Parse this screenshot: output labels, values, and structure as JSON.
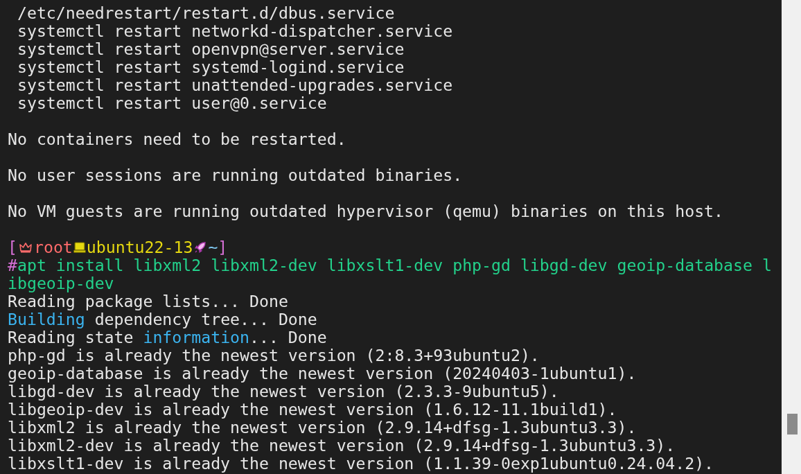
{
  "lines": [
    {
      "kind": "text",
      "segments": [
        {
          "text": " /etc/needrestart/restart.d/dbus.service",
          "color": "#e6e6e6"
        }
      ]
    },
    {
      "kind": "text",
      "segments": [
        {
          "text": " systemctl restart networkd-dispatcher.service",
          "color": "#e6e6e6"
        }
      ]
    },
    {
      "kind": "text",
      "segments": [
        {
          "text": " systemctl restart openvpn@server.service",
          "color": "#e6e6e6"
        }
      ]
    },
    {
      "kind": "text",
      "segments": [
        {
          "text": " systemctl restart systemd-logind.service",
          "color": "#e6e6e6"
        }
      ]
    },
    {
      "kind": "text",
      "segments": [
        {
          "text": " systemctl restart unattended-upgrades.service",
          "color": "#e6e6e6"
        }
      ]
    },
    {
      "kind": "text",
      "segments": [
        {
          "text": " systemctl restart user@0.service",
          "color": "#e6e6e6"
        }
      ]
    },
    {
      "kind": "blank"
    },
    {
      "kind": "text",
      "segments": [
        {
          "text": "No containers need to be restarted.",
          "color": "#e6e6e6"
        }
      ]
    },
    {
      "kind": "blank"
    },
    {
      "kind": "text",
      "segments": [
        {
          "text": "No user sessions are running outdated binaries.",
          "color": "#e6e6e6"
        }
      ]
    },
    {
      "kind": "blank"
    },
    {
      "kind": "text",
      "segments": [
        {
          "text": "No VM guests are running outdated hypervisor (qemu) binaries on this host.",
          "color": "#e6e6e6"
        }
      ]
    },
    {
      "kind": "blank"
    },
    {
      "kind": "prompt",
      "open": "[",
      "user": "root",
      "host": "ubuntu22-13",
      "cwd": "~",
      "close": "]"
    },
    {
      "kind": "text",
      "segments": [
        {
          "text": "#",
          "color": "#d670d6"
        },
        {
          "text": "apt install libxml2 libxml2-dev libxslt1-dev php-gd libgd-dev geoip-database l",
          "color": "#23d18b"
        }
      ]
    },
    {
      "kind": "text",
      "segments": [
        {
          "text": "ibgeoip-dev",
          "color": "#23d18b"
        }
      ]
    },
    {
      "kind": "text",
      "segments": [
        {
          "text": "Reading package lists... Done",
          "color": "#e6e6e6"
        }
      ]
    },
    {
      "kind": "text",
      "segments": [
        {
          "text": "Building",
          "color": "#3bb4f0"
        },
        {
          "text": " dependency tree... Done",
          "color": "#e6e6e6"
        }
      ]
    },
    {
      "kind": "text",
      "segments": [
        {
          "text": "Reading state ",
          "color": "#e6e6e6"
        },
        {
          "text": "information",
          "color": "#3bb4f0"
        },
        {
          "text": "... Done",
          "color": "#e6e6e6"
        }
      ]
    },
    {
      "kind": "text",
      "segments": [
        {
          "text": "php-gd is already the newest version (2:8.3+93ubuntu2).",
          "color": "#e6e6e6"
        }
      ]
    },
    {
      "kind": "text",
      "segments": [
        {
          "text": "geoip-database is already the newest version (20240403-1ubuntu1).",
          "color": "#e6e6e6"
        }
      ]
    },
    {
      "kind": "text",
      "segments": [
        {
          "text": "libgd-dev is already the newest version (2.3.3-9ubuntu5).",
          "color": "#e6e6e6"
        }
      ]
    },
    {
      "kind": "text",
      "segments": [
        {
          "text": "libgeoip-dev is already the newest version (1.6.12-11.1build1).",
          "color": "#e6e6e6"
        }
      ]
    },
    {
      "kind": "text",
      "segments": [
        {
          "text": "libxml2 is already the newest version (2.9.14+dfsg-1.3ubuntu3.3).",
          "color": "#e6e6e6"
        }
      ]
    },
    {
      "kind": "text",
      "segments": [
        {
          "text": "libxml2-dev is already the newest version (2.9.14+dfsg-1.3ubuntu3.3).",
          "color": "#e6e6e6"
        }
      ]
    },
    {
      "kind": "text",
      "segments": [
        {
          "text": "libxslt1-dev is already the newest version (1.1.39-0exp1ubuntu0.24.04.2).",
          "color": "#e6e6e6"
        }
      ]
    }
  ]
}
